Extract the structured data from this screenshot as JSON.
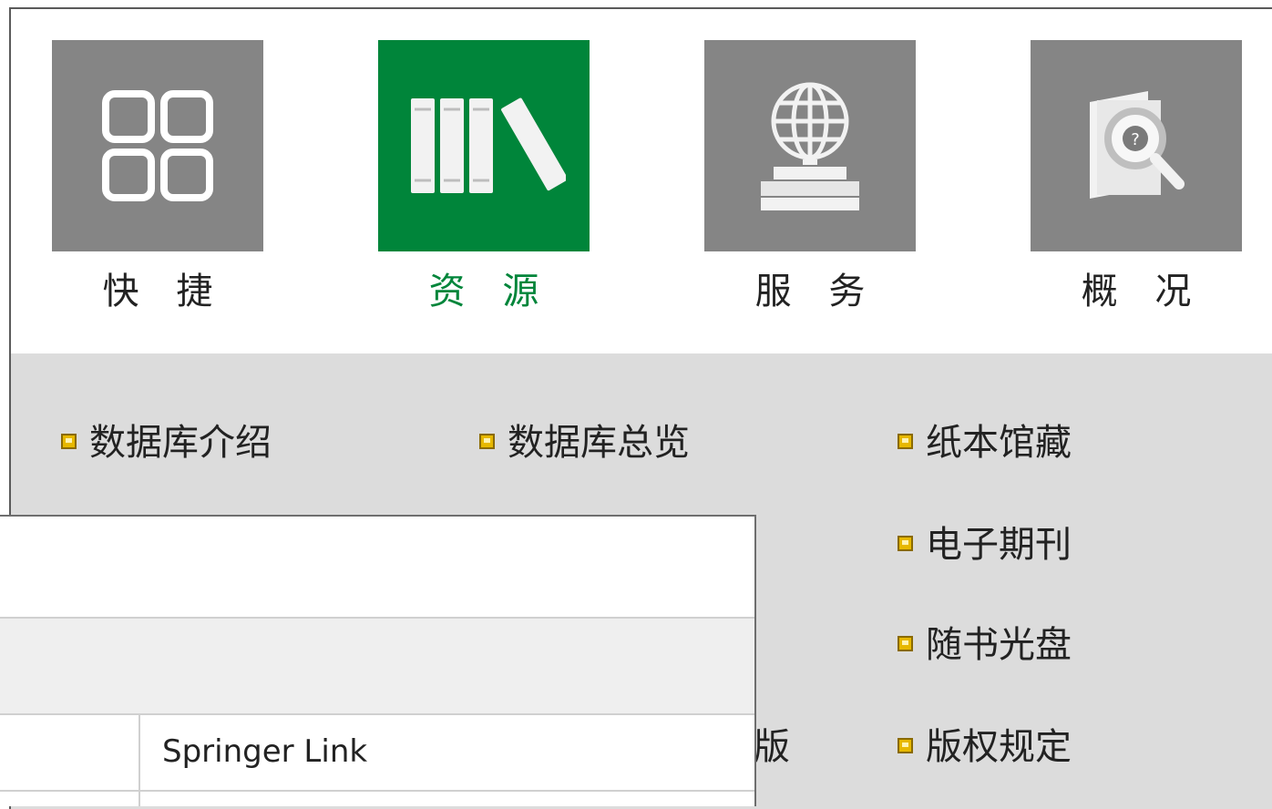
{
  "nav": {
    "items": [
      {
        "label": "快 捷",
        "icon": "grid-icon",
        "active": false
      },
      {
        "label": "资 源",
        "icon": "books-icon",
        "active": true
      },
      {
        "label": "服 务",
        "icon": "globe-books-icon",
        "active": false
      },
      {
        "label": "概 况",
        "icon": "document-search-icon",
        "active": false
      }
    ]
  },
  "submenu": {
    "links": [
      "数据库介绍",
      "数据库总览",
      "纸本馆藏",
      "电子期刊",
      "随书光盘",
      "版权规定"
    ],
    "partial_text": "版"
  },
  "popup": {
    "rows": [
      {
        "cell": "Springer Link"
      }
    ]
  },
  "colors": {
    "active": "#00853a",
    "tile": "#858585",
    "submenu_bg": "#dcdcdc",
    "bullet": "#e7b800"
  }
}
